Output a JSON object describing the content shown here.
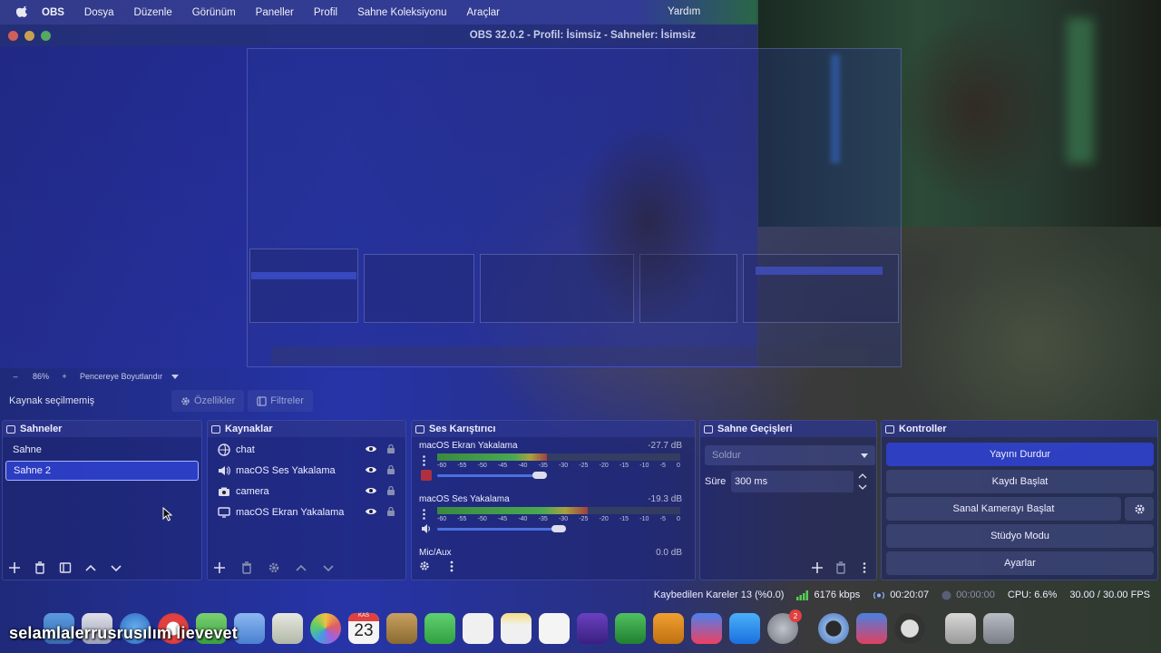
{
  "menubar": {
    "app": "OBS",
    "items": [
      "Dosya",
      "Düzenle",
      "Görünüm",
      "Paneller",
      "Profil",
      "Sahne Koleksiyonu",
      "Araçlar"
    ],
    "help": "Yardım"
  },
  "window": {
    "title": "OBS 32.0.2 - Profil: İsimsiz - Sahneler: İsimsiz"
  },
  "zoom": {
    "minus": "–",
    "value": "86%",
    "plus": "+",
    "fit": "Pencereye Boyutlandır"
  },
  "context": {
    "no_source": "Kaynak seçilmemiş",
    "properties": "Özellikler",
    "filters": "Filtreler"
  },
  "scenes": {
    "title": "Sahneler",
    "items": [
      "Sahne",
      "Sahne 2"
    ],
    "selected_index": 1
  },
  "sources": {
    "title": "Kaynaklar",
    "items": [
      {
        "label": "chat",
        "icon": "browser-icon"
      },
      {
        "label": "macOS Ses Yakalama",
        "icon": "speaker-icon"
      },
      {
        "label": "camera",
        "icon": "camera-icon"
      },
      {
        "label": "macOS Ekran Yakalama",
        "icon": "monitor-icon"
      }
    ]
  },
  "mixer": {
    "title": "Ses Karıştırıcı",
    "ticks": [
      "-60",
      "-55",
      "-50",
      "-45",
      "-40",
      "-35",
      "-30",
      "-25",
      "-20",
      "-15",
      "-10",
      "-5",
      "0"
    ],
    "channels": [
      {
        "name": "macOS Ekran Yakalama",
        "db": "-27.7 dB",
        "level": 0.45,
        "volume": 0.42
      },
      {
        "name": "macOS Ses Yakalama",
        "db": "-19.3 dB",
        "level": 0.62,
        "volume": 0.5
      },
      {
        "name": "Mic/Aux",
        "db": "0.0 dB",
        "level": 0.0,
        "volume": 0.0
      }
    ]
  },
  "transitions": {
    "title": "Sahne Geçişleri",
    "type": "Soldur",
    "duration_label": "Süre",
    "duration": "300 ms"
  },
  "controls": {
    "title": "Kontroller",
    "stop_stream": "Yayını Durdur",
    "start_recording": "Kaydı Başlat",
    "start_virtual_cam": "Sanal Kamerayı Başlat",
    "studio_mode": "Stüdyo Modu",
    "settings": "Ayarlar"
  },
  "status": {
    "dropped_frames": "Kaybedilen Kareler 13 (%0.0)",
    "bitrate": "6176 kbps",
    "stream_time": "00:20:07",
    "record_time": "00:00:00",
    "cpu": "CPU: 6.6%",
    "fps": "30.00 / 30.00 FPS"
  },
  "dock": {
    "calendar_month": "KAS",
    "calendar_day": "23",
    "settings_badge": "2"
  },
  "overlay": {
    "text": "selamlalerrusrusılım lievevet"
  },
  "colors": {
    "accent": "#3246e6",
    "selection": "#3246dc",
    "meter_green": "#4aa850"
  }
}
